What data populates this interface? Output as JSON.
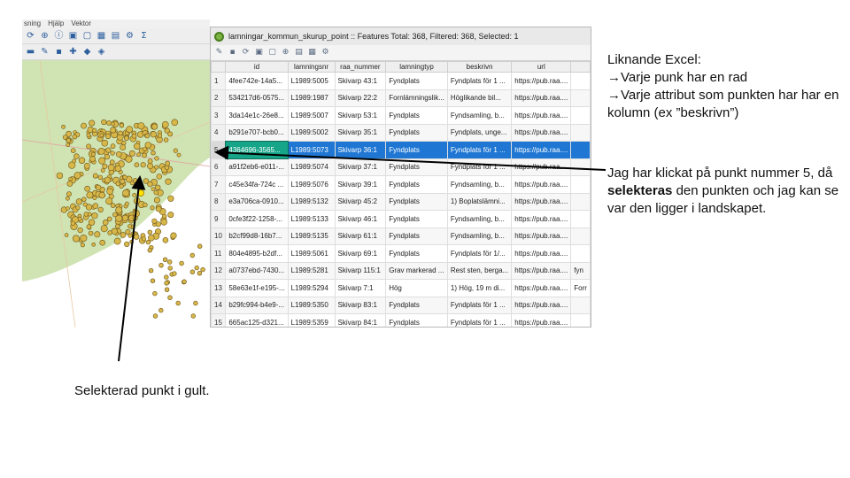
{
  "map_window": {
    "menu": [
      "sning",
      "Hjälp",
      "Vektor"
    ],
    "toolbar_icons": [
      "refresh-icon",
      "zoom-icon",
      "identify-icon",
      "select-icon",
      "deselect-icon",
      "table-icon",
      "calculator-icon",
      "settings-icon",
      "sum-icon"
    ],
    "toolbar2_icons": [
      "layer-icon",
      "edit-icon",
      "save-icon",
      "digitize-icon",
      "node-icon",
      "label-icon"
    ],
    "colors": {
      "land": "#cfe3b3",
      "sea": "#ffffff",
      "point": "#d8b74a",
      "point_stroke": "#6b5416",
      "selected_point": "#ffe600"
    }
  },
  "attribute_table": {
    "title": "lamningar_kommun_skurup_point :: Features Total: 368, Filtered: 368, Selected: 1",
    "columns": [
      "id",
      "lamningsnr",
      "raa_nummer",
      "lamningtyp",
      "beskrivn",
      "url"
    ],
    "rows": [
      {
        "n": "1",
        "cells": [
          "4fee742e-14a5...",
          "L1989:5005",
          "Skivarp 43:1",
          "Fyndplats",
          "Fyndplats för 1 ...",
          "https://pub.raa...."
        ]
      },
      {
        "n": "2",
        "cells": [
          "534217d6-0575...",
          "L1989:1987",
          "Skivarp 22:2",
          "Fornlämningslik...",
          "Höglikande bil...",
          "https://pub.raa...."
        ]
      },
      {
        "n": "3",
        "cells": [
          "3da14e1c-26e8...",
          "L1989:5007",
          "Skivarp 53:1",
          "Fyndplats",
          "Fyndsamling, b...",
          "https://pub.raa...."
        ]
      },
      {
        "n": "4",
        "cells": [
          "b291e707-bcb0...",
          "L1989:5002",
          "Skivarp 35:1",
          "Fyndplats",
          "Fyndplats, unge...",
          "https://pub.raa...."
        ]
      },
      {
        "n": "5",
        "cells": [
          "4364696-3565...",
          "L1989:5073",
          "Skivarp 36:1",
          "Fyndplats",
          "Fyndplats för 1 ...",
          "https://pub.raa...."
        ]
      },
      {
        "n": "6",
        "cells": [
          "a91f2eb6-e011-...",
          "L1989:5074",
          "Skivarp 37:1",
          "Fyndplats",
          "Fyndplats för 1 ...",
          "https://pub.raa...."
        ]
      },
      {
        "n": "7",
        "cells": [
          "c45e34fa-724c ...",
          "L1989:5076",
          "Skivarp 39:1",
          "Fyndplats",
          "Fyndsamling, b...",
          "https://pub.raa...."
        ]
      },
      {
        "n": "8",
        "cells": [
          "e3a706ca-0910...",
          "L1989:5132",
          "Skivarp 45:2",
          "Fyndplats",
          "1) Boplatslämni...",
          "https://pub.raa...."
        ]
      },
      {
        "n": "9",
        "cells": [
          "0cfe3f22-1258-...",
          "L1989:5133",
          "Skivarp 46:1",
          "Fyndplats",
          "Fyndsamling, b...",
          "https://pub.raa...."
        ]
      },
      {
        "n": "10",
        "cells": [
          "b2cf99d8-16b7...",
          "L1989:5135",
          "Skivarp 61:1",
          "Fyndplats",
          "Fyndsamling, b...",
          "https://pub.raa...."
        ]
      },
      {
        "n": "11",
        "cells": [
          "804e4895-b2df...",
          "L1989:5061",
          "Skivarp 69:1",
          "Fyndplats",
          "Fyndplats för 1/...",
          "https://pub.raa...."
        ]
      },
      {
        "n": "12",
        "cells": [
          "a0737ebd-7430...",
          "L1989:5281",
          "Skivarp 115:1",
          "Grav markerad ...",
          "Rest sten, berga...",
          "https://pub.raa...."
        ],
        "extra": "fyn"
      },
      {
        "n": "13",
        "cells": [
          "58e63e1f-e195-...",
          "L1989:5294",
          "Skivarp 7:1",
          "Hög",
          "1) Hög, 19 m di...",
          "https://pub.raa...."
        ],
        "extra": "Forr"
      },
      {
        "n": "14",
        "cells": [
          "b29fc994-b4e9-...",
          "L1989:5350",
          "Skivarp 83:1",
          "Fyndplats",
          "Fyndplats för 1 ...",
          "https://pub.raa...."
        ]
      },
      {
        "n": "15",
        "cells": [
          "665ac125-d321...",
          "L1989:5359",
          "Skivarp 84:1",
          "Fyndplats",
          "Fyndplats för 1 ...",
          "https://pub.raa...."
        ]
      }
    ],
    "selected_row": "5",
    "colors": {
      "selected": "#1f77d3",
      "focus": "#17a589"
    }
  },
  "annotations": {
    "excel_heading": "Liknande Excel:",
    "excel_line1": "Varje punk har en rad",
    "excel_line2": "Varje attribut som punkten har har en kolumn (ex ”beskrivn”)",
    "click_text_1": "Jag har klickat på punkt nummer 5, då ",
    "click_bold": "selekteras",
    "click_text_2": " den punkten och jag kan se var den ligger i landskapet.",
    "yellow_text": "Selekterad punkt i gult."
  }
}
